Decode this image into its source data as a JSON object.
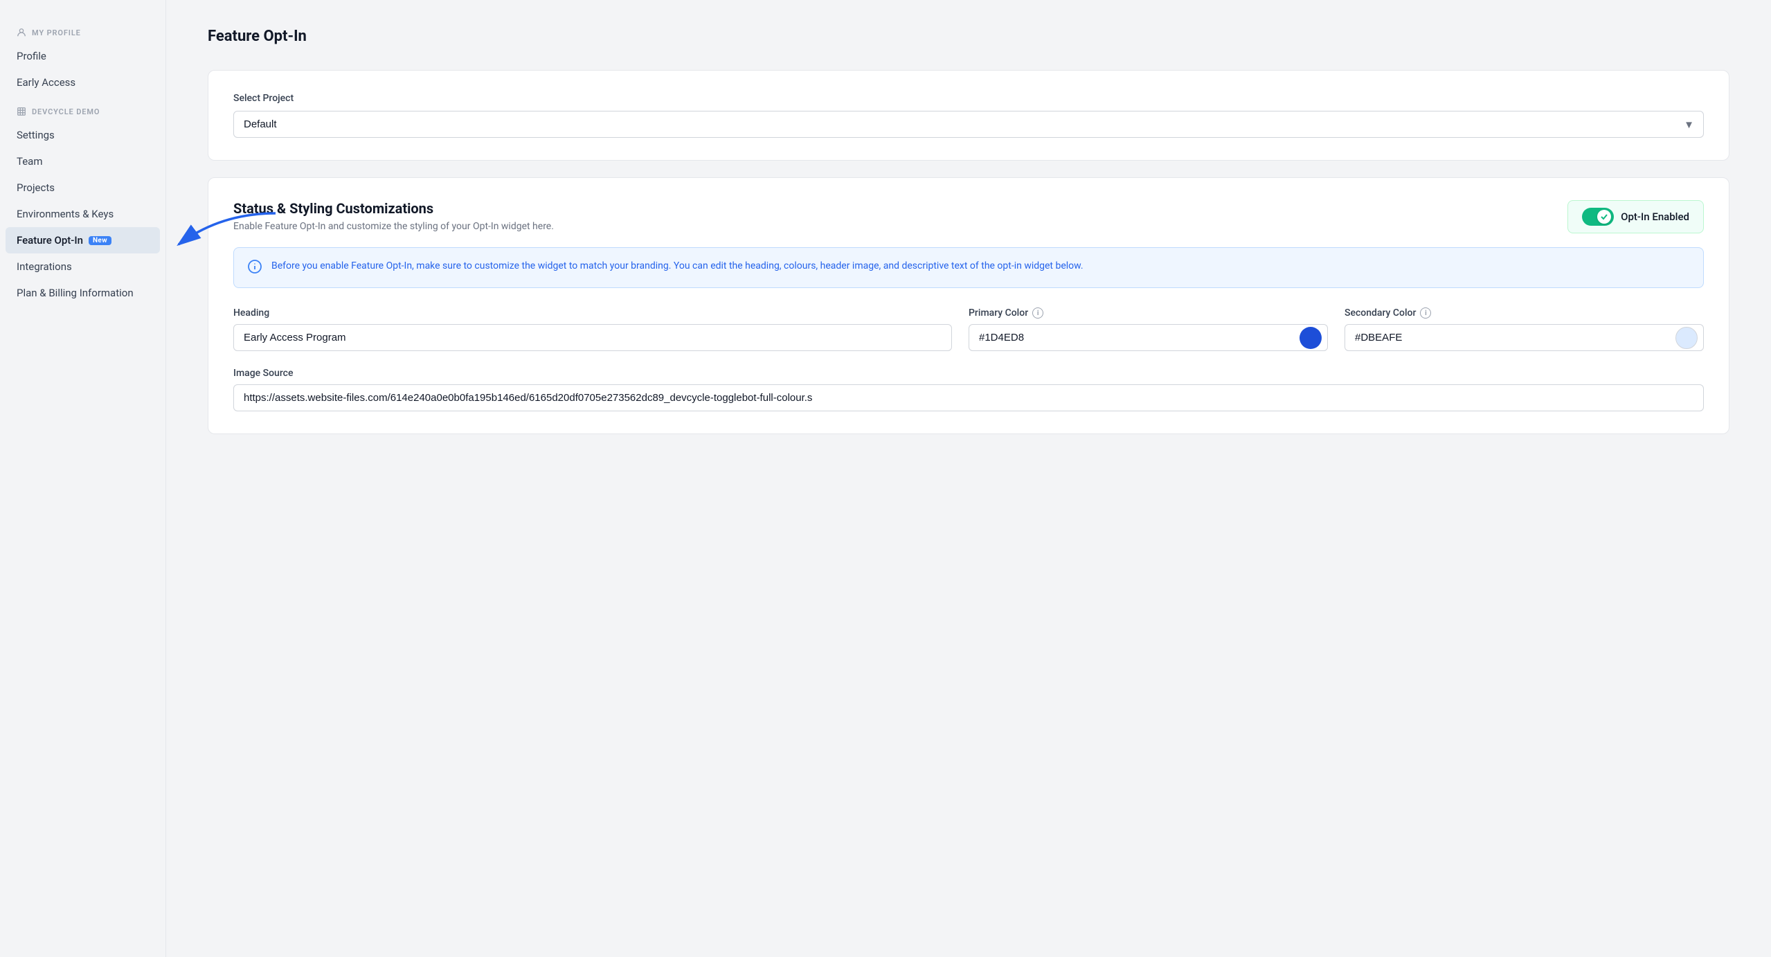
{
  "page": {
    "title": "Feature Opt-In"
  },
  "sidebar": {
    "my_profile_label": "MY PROFILE",
    "devcycle_label": "DEVCYCLE DEMO",
    "items_profile": [
      {
        "id": "profile",
        "label": "Profile",
        "active": false
      },
      {
        "id": "early-access",
        "label": "Early Access",
        "active": false
      }
    ],
    "items_org": [
      {
        "id": "settings",
        "label": "Settings",
        "active": false
      },
      {
        "id": "team",
        "label": "Team",
        "active": false
      },
      {
        "id": "projects",
        "label": "Projects",
        "active": false
      },
      {
        "id": "environments-keys",
        "label": "Environments & Keys",
        "active": false
      },
      {
        "id": "feature-opt-in",
        "label": "Feature Opt-In",
        "active": true,
        "badge": "New"
      },
      {
        "id": "integrations",
        "label": "Integrations",
        "active": false
      },
      {
        "id": "plan-billing",
        "label": "Plan & Billing Information",
        "active": false
      }
    ]
  },
  "select_project": {
    "label": "Select Project",
    "value": "Default",
    "options": [
      "Default"
    ]
  },
  "status_section": {
    "title": "Status & Styling Customizations",
    "description": "Enable Feature Opt-In and customize the styling of your Opt-In widget here.",
    "opt_in_enabled_label": "Opt-In Enabled",
    "info_banner": "Before you enable Feature Opt-In, make sure to customize the widget to match your branding. You can edit the heading, colours, header image, and descriptive text of the opt-in widget below."
  },
  "form": {
    "heading_label": "Heading",
    "heading_value": "Early Access Program",
    "primary_color_label": "Primary Color",
    "primary_color_value": "#1D4ED8",
    "primary_color_swatch": "#1D4ED8",
    "secondary_color_label": "Secondary Color",
    "secondary_color_value": "#DBEAFE",
    "secondary_color_swatch": "#DBEAFE",
    "image_source_label": "Image Source",
    "image_source_value": "https://assets.website-files.com/614e240a0e0b0fa195b146ed/6165d20df0705e273562dc89_devcycle-togglebot-full-colour.s"
  },
  "icons": {
    "person": "👤",
    "building": "🏢",
    "chevron_down": "▾",
    "info_circle": "i",
    "check": "✓"
  }
}
